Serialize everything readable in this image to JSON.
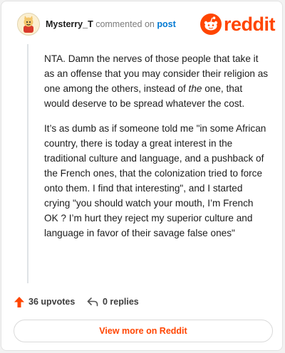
{
  "comment": {
    "username": "Mysterry_T",
    "action_text": "commented on",
    "post_link": "post",
    "paragraphs": [
      "NTA. Damn the nerves of those people that take it as an offense that you may consider their religion as one among the others, instead of ",
      "It’s as dumb as if someone told me \"in some African country, there is today a great interest in the traditional culture and language, and a pushback of the French ones, that the colonization tried to force onto them. I find that interesting\", and I started crying \"you should watch your mouth, I’m French OK ? I’m hurt they reject my superior culture and language in favor of their savage false ones\""
    ],
    "para1_emphasis": "the",
    "para1_tail": " one, that would deserve to be spread whatever the cost."
  },
  "brand": {
    "logo_text": "reddit",
    "accent_color": "#ff4500"
  },
  "footer": {
    "upvotes_label": "36 upvotes",
    "replies_label": "0 replies",
    "upvote_icon": "upvote-arrow-icon",
    "reply_icon": "reply-arrow-icon"
  },
  "view_more_label": "View more on Reddit"
}
